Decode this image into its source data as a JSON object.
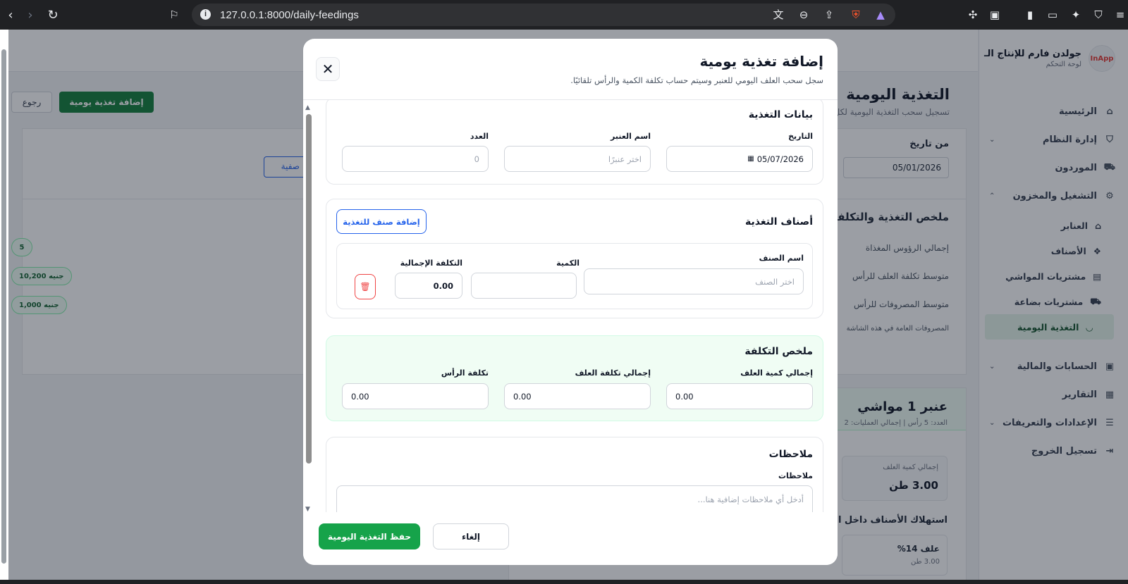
{
  "browser": {
    "url": "127.0.0.1:8000/daily-feedings"
  },
  "sidebar": {
    "brand_logo": "InApp",
    "brand_name": "جولدن فارم للإنتاج الـ",
    "brand_sub": "لوحة التحكم",
    "items": [
      {
        "label": "الرئيسية",
        "icon": "⌂"
      },
      {
        "label": "إدارة النظام",
        "icon": "⛉"
      },
      {
        "label": "الموردون",
        "icon": "⛟"
      },
      {
        "label": "التشغيل والمخزون",
        "icon": "⚙"
      },
      {
        "label": "العنابر",
        "icon": "⌂"
      },
      {
        "label": "الأصناف",
        "icon": "❖"
      },
      {
        "label": "مشتريات المواشي",
        "icon": "▤"
      },
      {
        "label": "مشتريات بضاعة",
        "icon": "⛟"
      },
      {
        "label": "التغذية اليومية",
        "icon": "◡"
      },
      {
        "label": "الحسابات والمالية",
        "icon": "▣"
      },
      {
        "label": "التقارير",
        "icon": "▦"
      },
      {
        "label": "الإعدادات والتعريفات",
        "icon": "☰"
      },
      {
        "label": "تسجيل الخروج",
        "icon": "⇥"
      }
    ]
  },
  "background": {
    "title": "التغذية اليومية",
    "subtitle": "تسجيل سحب التغذية اليومية لكل",
    "add_button": "إضافة تغذية يومية",
    "back_button": "رجوع",
    "filter_label": "من تاريخ",
    "filter_date": "05/01/2026",
    "filter_button": "صفية",
    "summary_title": "ملخص التغذية والتكلفة",
    "summary_rows": [
      "إجمالي الرؤوس المغذاة",
      "متوسط تكلفة العلف للرأس",
      "متوسط المصروفات للرأس",
      "المصروفات العامة في هذه الشاشة"
    ],
    "pills": [
      "5",
      "10,200 جنيه",
      "1,000 جنيه"
    ],
    "card_title": "عنبر 1 مواشي",
    "card_sub": "العدد: 5 رأس | إجمالي العمليات: 2",
    "stat_label": "إجمالي كمية العلف",
    "stat_value": "3.00 طن",
    "usage_title": "استهلاك الأصناف داخل العنبر",
    "feed_name": "علف 14%",
    "feed_value": "3.00 طن"
  },
  "modal": {
    "title": "إضافة تغذية يومية",
    "subtitle": "سجل سحب العلف اليومي للعنبر وسيتم حساب تكلفة الكمية والرأس تلقائيًا.",
    "feeding_data": {
      "title": "بيانات التغذية",
      "date_label": "التاريخ",
      "date_value": "05/07/2026",
      "barn_label": "اسم العنبر",
      "barn_placeholder": "اختر عنبرًا",
      "count_label": "العدد",
      "count_placeholder": "0"
    },
    "items": {
      "title": "أصناف التغذية",
      "add_button": "إضافة صنف للتغذية",
      "item_label": "اسم الصنف",
      "item_placeholder": "اختر الصنف",
      "qty_label": "الكمية",
      "qty_value": "",
      "total_label": "التكلفة الإجمالية",
      "total_value": "0.00"
    },
    "cost": {
      "title": "ملخص التكلفة",
      "total_qty_label": "إجمالي كمية العلف",
      "total_qty_value": "0.00",
      "total_cost_label": "إجمالي تكلفة العلف",
      "total_cost_value": "0.00",
      "head_cost_label": "تكلفة الرأس",
      "head_cost_value": "0.00"
    },
    "notes": {
      "title": "ملاحظات",
      "label": "ملاحظات",
      "placeholder": "أدخل أي ملاحظات إضافية هنا..."
    },
    "save_button": "حفظ التغذية اليومية",
    "cancel_button": "إلغاء"
  }
}
